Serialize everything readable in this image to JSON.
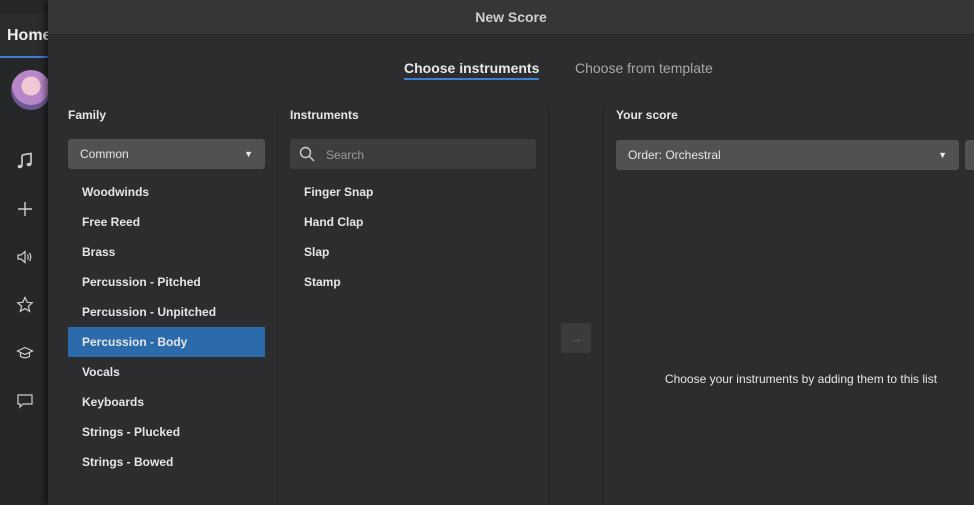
{
  "app": {
    "home_tab": "Home",
    "sidebar_icons": [
      "music-note-icon",
      "plus-icon",
      "speaker-icon",
      "star-icon",
      "graduation-cap-icon",
      "chat-icon"
    ]
  },
  "dialog": {
    "title": "New Score",
    "tabs": [
      {
        "label": "Choose instruments",
        "active": true
      },
      {
        "label": "Choose from template",
        "active": false
      }
    ],
    "family": {
      "header": "Family",
      "dropdown_value": "Common",
      "items": [
        "Woodwinds",
        "Free Reed",
        "Brass",
        "Percussion - Pitched",
        "Percussion - Unpitched",
        "Percussion - Body",
        "Vocals",
        "Keyboards",
        "Strings - Plucked",
        "Strings - Bowed"
      ],
      "selected": "Percussion - Body"
    },
    "instruments": {
      "header": "Instruments",
      "search_placeholder": "Search",
      "items": [
        "Finger Snap",
        "Hand Clap",
        "Slap",
        "Stamp"
      ]
    },
    "score": {
      "header": "Your score",
      "order_value": "Order: Orchestral",
      "empty_message": "Choose your instruments by adding them to this list"
    },
    "colors": {
      "accent": "#3b82d6",
      "selection": "#2b6aab",
      "dialog_bg": "#2d2d2f"
    }
  }
}
